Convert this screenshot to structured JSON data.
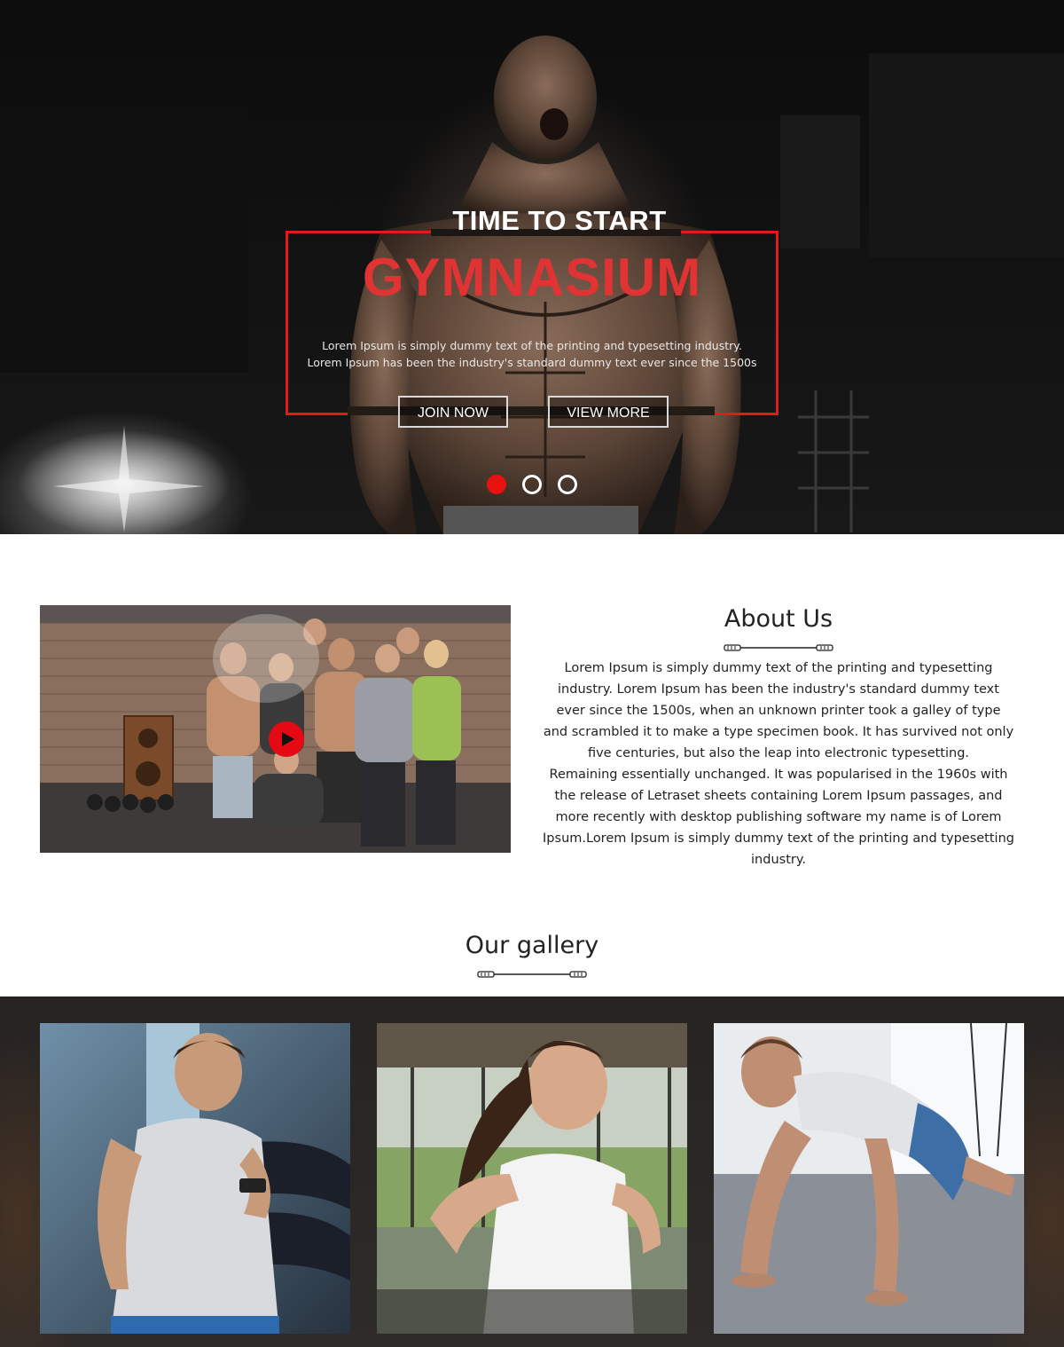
{
  "hero": {
    "kicker": "TIME TO START",
    "title": "GYMNASIUM",
    "description": "Lorem Ipsum is simply dummy text of the printing and typesetting industry. Lorem Ipsum has been the industry's standard dummy text ever since the 1500s",
    "buttons": {
      "join": "JOIN NOW",
      "more": "VIEW MORE"
    },
    "slides": 3,
    "active_slide": 1,
    "accent_color": "#e11b1b",
    "title_color": "#e03333"
  },
  "about": {
    "title": "About Us",
    "paragraphs": [
      "Lorem Ipsum is simply dummy text of the printing and typesetting industry. Lorem Ipsum has been the industry's standard dummy text ever since the 1500s, when an unknown printer took a galley of type and scrambled it to make a type specimen book. It has survived not only five centuries, but also the leap into electronic typesetting.",
      "Remaining essentially unchanged. It was popularised in the 1960s with the release of Letraset sheets containing Lorem Ipsum passages, and more recently with desktop publishing software my name is of Lorem Ipsum.Lorem Ipsum is simply dummy text of the printing and typesetting industry."
    ],
    "play_icon": "play-icon",
    "play_color": "#e50914"
  },
  "gallery": {
    "title": "Our gallery",
    "divider_icon": "jump-rope-icon"
  }
}
